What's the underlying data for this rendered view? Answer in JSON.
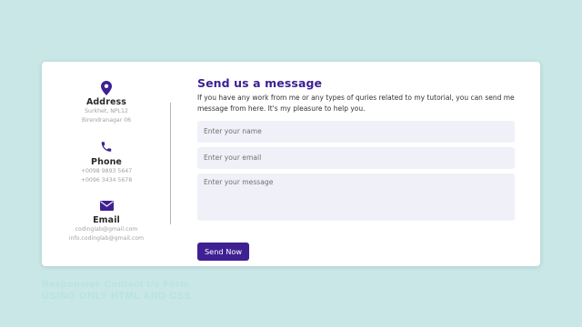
{
  "colors": {
    "background": "#c9e7e7",
    "card": "#ffffff",
    "accent": "#3e2093",
    "field_bg": "#f0f1f8",
    "caption": "#b9e3e3"
  },
  "contact_info": [
    {
      "icon": "map-marker-icon",
      "title": "Address",
      "lines": [
        "Surkhet, NPL12",
        "Birendranagar 06"
      ]
    },
    {
      "icon": "phone-icon",
      "title": "Phone",
      "lines": [
        "+0098 9893 5647",
        "+0096 3434 5678"
      ]
    },
    {
      "icon": "envelope-icon",
      "title": "Email",
      "lines": [
        "codinglab@gmail.com",
        "info.codinglab@gmail.com"
      ]
    }
  ],
  "form": {
    "heading": "Send us a message",
    "description": "If you have any work from me or any types of quries related to my tutorial, you can send me message from here. It's my pleasure to help you.",
    "name_placeholder": "Enter your name",
    "email_placeholder": "Enter your email",
    "message_placeholder": "Enter your message",
    "submit_label": "Send Now"
  },
  "caption": {
    "line1": "Responsive Contact Us Form",
    "line2": "USING ONLY HTML AND CSS"
  }
}
